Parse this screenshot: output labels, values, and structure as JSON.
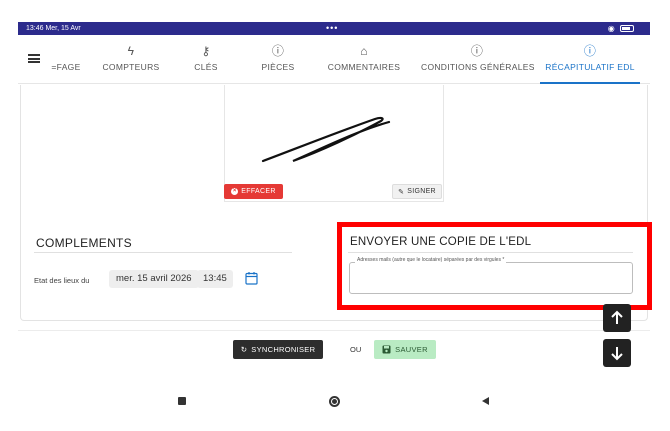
{
  "status_bar": {
    "time": "13:46  Mer, 15 Avr",
    "dots": "•••",
    "wifi_icon": "wifi-icon",
    "battery_icon": "battery-icon"
  },
  "tabs": [
    {
      "label": "=FAGE",
      "icon": "none",
      "active": false
    },
    {
      "label": "COMPTEURS",
      "icon": "bolt-icon",
      "active": false
    },
    {
      "label": "CLÉS",
      "icon": "key-icon",
      "active": false
    },
    {
      "label": "PIÈCES",
      "icon": "info-icon",
      "active": false
    },
    {
      "label": "COMMENTAIRES",
      "icon": "home-icon",
      "active": false
    },
    {
      "label": "CONDITIONS GÉNÉRALES",
      "icon": "info-icon",
      "active": false
    },
    {
      "label": "RÉCAPITULATIF EDL",
      "icon": "info-icon",
      "active": true
    }
  ],
  "signature": {
    "erase_label": "EFFACER",
    "sign_label": "SIGNER"
  },
  "complements": {
    "title": "COMPLEMENTS",
    "edl_label": "Etat des lieux du",
    "date_value": "mer. 15 avril 2026",
    "time_value": "13:45"
  },
  "send_copy": {
    "title": "ENVOYER UNE COPIE DE L'EDL",
    "email_label": "Adresses mails (autre que le locataire) séparées par des virgules *",
    "email_value": ""
  },
  "actions": {
    "sync_label": "SYNCHRONISER",
    "or_text": "OU",
    "save_label": "SAUVER"
  },
  "colors": {
    "accent": "#1a73c8",
    "status_bar": "#2c2b8c",
    "erase": "#e53935",
    "save": "#b9ebc3",
    "highlight": "#ff0000"
  }
}
